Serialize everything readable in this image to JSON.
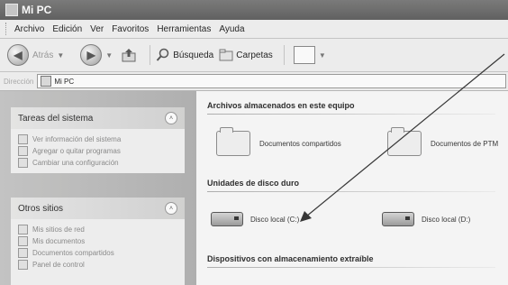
{
  "window": {
    "title": "Mi PC"
  },
  "menu": [
    "Archivo",
    "Edición",
    "Ver",
    "Favoritos",
    "Herramientas",
    "Ayuda"
  ],
  "toolbar": {
    "back_label": "Atrás",
    "search_label": "Búsqueda",
    "folders_label": "Carpetas"
  },
  "address": {
    "label": "Dirección",
    "value": "Mi PC"
  },
  "tasks": {
    "title": "Tareas del sistema",
    "items": [
      "Ver información del sistema",
      "Agregar o quitar programas",
      "Cambiar una configuración"
    ]
  },
  "places": {
    "title": "Otros sitios",
    "items": [
      "Mis sitios de red",
      "Mis documentos",
      "Documentos compartidos",
      "Panel de control"
    ]
  },
  "main": {
    "stored_header": "Archivos almacenados en este equipo",
    "stored": [
      "Documentos compartidos",
      "Documentos de PTM"
    ],
    "drives_header": "Unidades de disco duro",
    "drives": [
      "Disco local (C:)",
      "Disco local (D:)"
    ],
    "removable_header": "Dispositivos con almacenamiento extraíble"
  }
}
